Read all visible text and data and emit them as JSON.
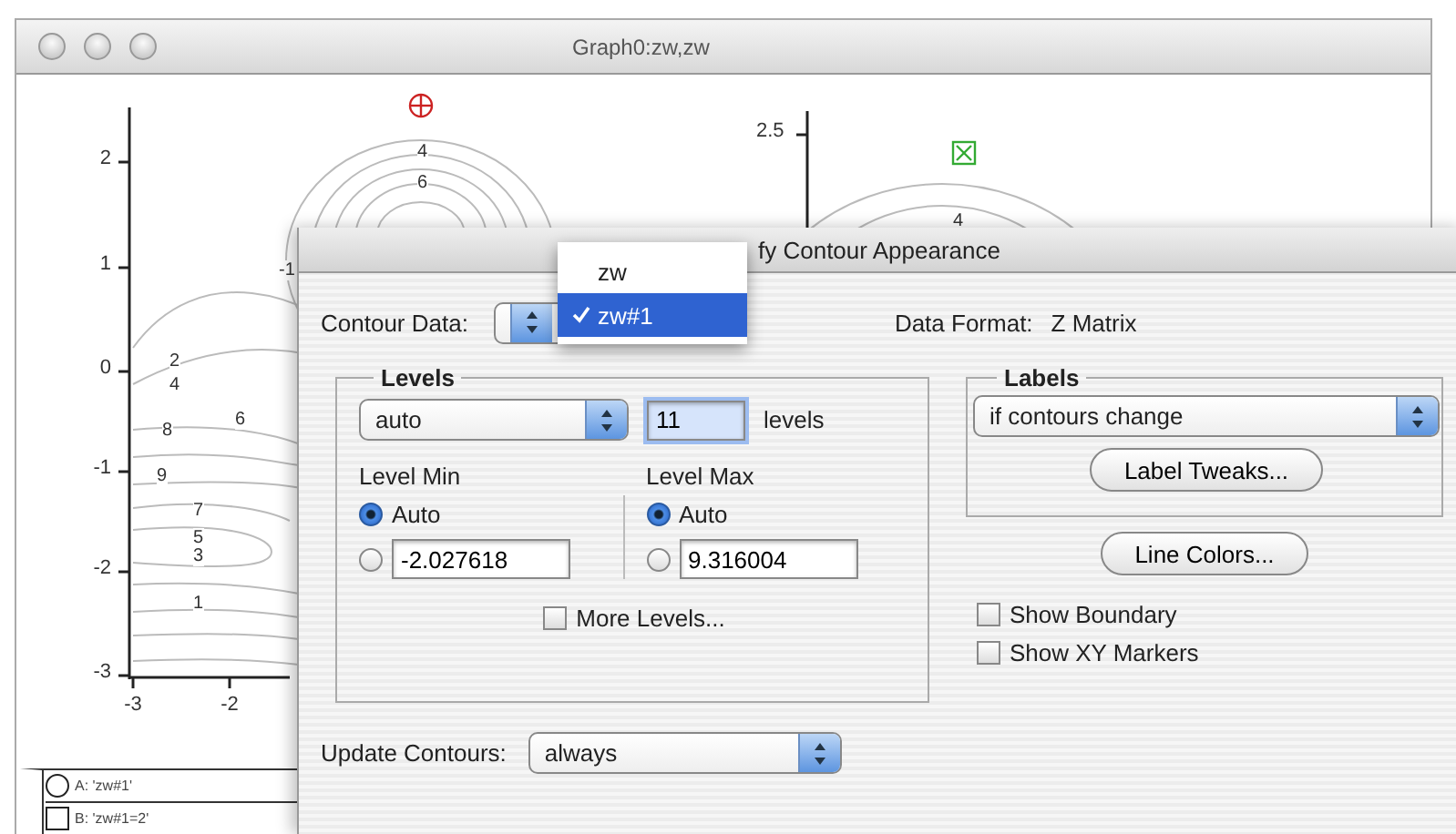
{
  "window": {
    "title": "Graph0:zw,zw"
  },
  "graph": {
    "left_plot": {
      "y_ticks": [
        "2",
        "1",
        "0",
        "-1",
        "-2",
        "-3"
      ],
      "x_ticks": [
        "-3",
        "-2"
      ],
      "contour_labels": [
        "4",
        "6",
        "-1",
        "2",
        "4",
        "8",
        "6",
        "9",
        "7",
        "5",
        "3",
        "1"
      ]
    },
    "right_plot": {
      "y_ticks": [
        "2.5"
      ],
      "contour_labels": [
        "4"
      ]
    },
    "legend": [
      {
        "label": "A: 'zw#1'",
        "kind": "circle"
      },
      {
        "label": "B: 'zw#1=2'",
        "kind": "square"
      }
    ]
  },
  "dialog": {
    "title": "fy Contour Appearance",
    "contour_data": {
      "label": "Contour Data:"
    },
    "data_format": {
      "label": "Data Format:",
      "value": "Z Matrix"
    },
    "menu": [
      {
        "label": "zw",
        "selected": false
      },
      {
        "label": "zw#1",
        "selected": true
      }
    ],
    "levels": {
      "title": "Levels",
      "mode": "auto",
      "count": "11",
      "count_unit": "levels",
      "level_min": {
        "label": "Level Min",
        "options": [
          {
            "label": "Auto",
            "selected": true
          },
          {
            "selected": false,
            "value": "-2.027618"
          }
        ]
      },
      "level_max": {
        "label": "Level Max",
        "options": [
          {
            "label": "Auto",
            "selected": true
          },
          {
            "selected": false,
            "value": "9.316004"
          }
        ]
      },
      "more_levels": {
        "label": "More Levels...",
        "checked": false
      }
    },
    "labels": {
      "title": "Labels",
      "mode": "if contours change",
      "button": "Label Tweaks..."
    },
    "line_colors_button": "Line Colors...",
    "checkboxes": [
      {
        "label": "Show Boundary",
        "checked": false
      },
      {
        "label": "Show XY Markers",
        "checked": false
      }
    ],
    "update": {
      "label": "Update Contours:",
      "value": "always"
    }
  }
}
